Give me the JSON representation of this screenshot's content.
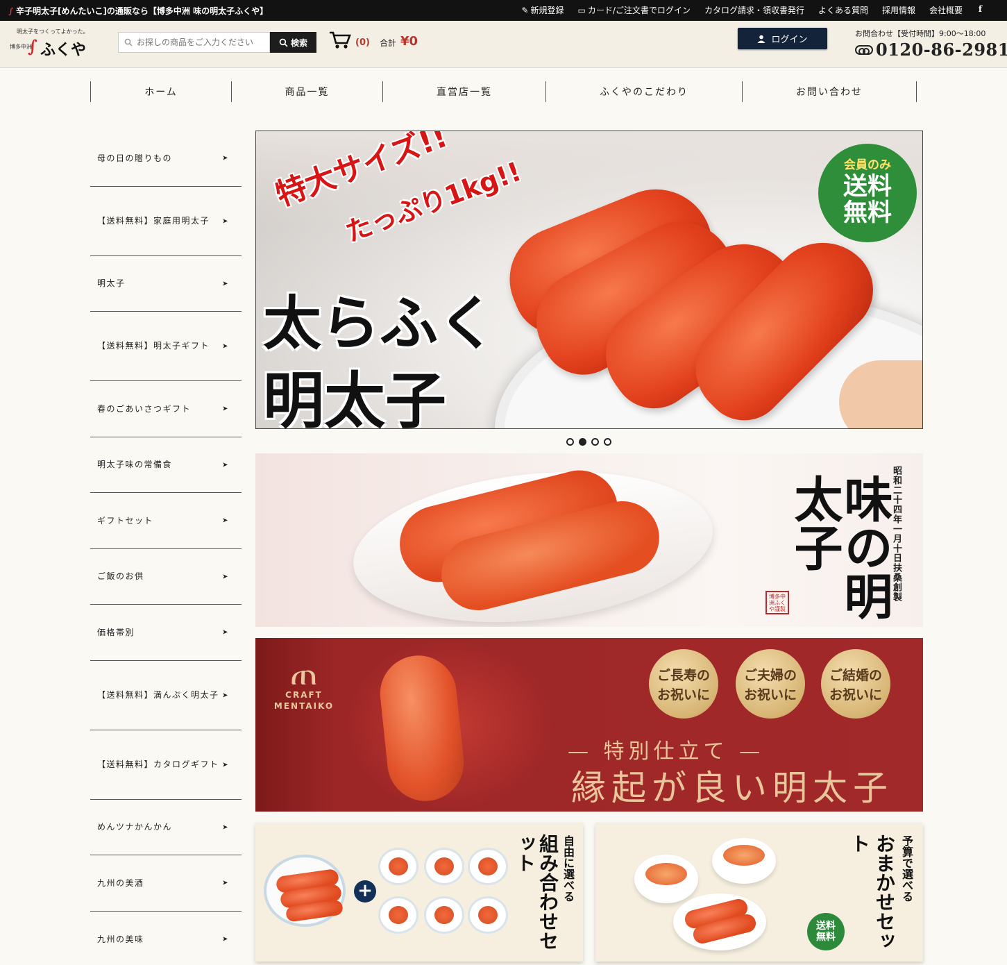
{
  "topbar": {
    "site_title": "辛子明太子[めんたいこ]の通販なら【博多中洲 味の明太子ふくや】",
    "links": [
      "新規登録",
      "カード/ご注文書でログイン",
      "カタログ請求・領収書発行",
      "よくある質問",
      "採用情報",
      "会社概要"
    ],
    "facebook": "f"
  },
  "header": {
    "tagline": "明太子をつくってよかった。",
    "brand_sub": "博多中洲",
    "brand_name": "ふくや",
    "search_placeholder": "お探しの商品をご入力ください",
    "search_button": "検索",
    "cart_count": "(0)",
    "total_label": "合計",
    "total_value": "¥0",
    "login_button": "ログイン",
    "contact_label": "お問合わせ【受付時間】9:00～18:00",
    "phone": "0120-86-2981"
  },
  "nav": [
    "ホーム",
    "商品一覧",
    "直営店一覧",
    "ふくやのこだわり",
    "お問い合わせ"
  ],
  "sidebar": [
    "母の日の贈りもの",
    "【送料無料】家庭用明太子",
    "明太子",
    "【送料無料】明太子ギフト",
    "春のごあいさつギフト",
    "明太子味の常備食",
    "ギフトセット",
    "ご飯のお供",
    "価格帯別",
    "【送料無料】満んぷく明太子",
    "【送料無料】カタログギフト",
    "めんツナかんかん",
    "九州の美酒",
    "九州の美味"
  ],
  "hero": {
    "copy1": "特大サイズ!!",
    "copy2": "たっぷり1kg!!",
    "title1": "太らふく",
    "title2": "明太子",
    "badge_top": "会員のみ",
    "badge_main": "送料無料"
  },
  "carousel": {
    "slides": 4,
    "active": 2
  },
  "banner2": {
    "calligraphy": "味の明太子",
    "since": "昭和二十四年一月十日扶桑創製",
    "seal": "博多中洲ふくや謹製"
  },
  "banner3": {
    "logo_text": "CRAFT MENTAIKO",
    "coins": [
      "ご長寿の お祝いに",
      "ご夫婦の お祝いに",
      "ご結婚の お祝いに"
    ],
    "subtitle": "— 特別仕立て —",
    "title": "縁起が良い明太子"
  },
  "card1": {
    "small": "自由に選べる",
    "title": "組み合わせセット"
  },
  "card2": {
    "small": "予算で選べる",
    "title": "おまかせセット",
    "badge": "送料無料"
  },
  "colors": {
    "accent_red": "#b8372c",
    "login_navy": "#13243a",
    "badge_green": "#2e8e3a",
    "banner_red": "#a2292a",
    "gold": "#e9c59c"
  }
}
